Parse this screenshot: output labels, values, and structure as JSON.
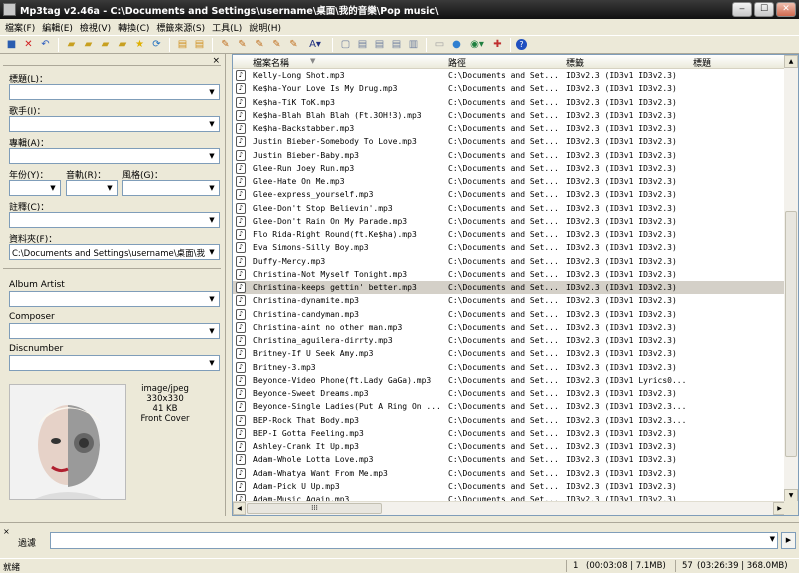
{
  "window": {
    "title": "Mp3tag v2.46a  -  C:\\Documents and Settings\\username\\桌面\\我的音樂\\Pop music\\",
    "min_glyph": "‒",
    "max_glyph": "☐",
    "close_glyph": "✕"
  },
  "menu": [
    "檔案(F)",
    "編輯(E)",
    "檢視(V)",
    "轉換(C)",
    "標籤來源(S)",
    "工具(L)",
    "說明(H)"
  ],
  "toolbar_icons": [
    "save-icon",
    "remove-tag-icon",
    "undo-icon",
    "change-dir-icon",
    "add-dir-icon",
    "open-folder-icon",
    "folder-icon",
    "favorite-star-icon",
    "refresh-icon",
    "tag-to-filename-icon",
    "filename-to-tag-icon",
    "format-icon",
    "actions-icon",
    "quick-action-icon",
    "convert-icon",
    "web-source-icon",
    "case-conversion-icon",
    "edit-icon",
    "text-export-icon",
    "playlist-icon",
    "tag-sources-icon",
    "print-icon",
    "web-icon",
    "options-icon",
    "tools-icon",
    "help-icon"
  ],
  "left_panel": {
    "close_glyph": "×",
    "title_label": "標題(L)：",
    "artist_label": "歌手(I)：",
    "album_label": "專輯(A)：",
    "year_label": "年份(Y)：",
    "track_label": "音軌(R)：",
    "genre_label": "風格(G)：",
    "comment_label": "註釋(C)：",
    "directory_label": "資料夾(F)：",
    "directory_value": "C:\\Documents and Settings\\username\\桌面\\我的音",
    "album_artist_label": "Album Artist",
    "composer_label": "Composer",
    "discnumber_label": "Discnumber",
    "cover": {
      "mime": "image/jpeg",
      "dimensions": "330x330",
      "size": "41 KB",
      "type": "Front Cover"
    }
  },
  "file_list": {
    "columns": [
      "檔案名稱",
      "路徑",
      "標籤",
      "標題"
    ],
    "selected_index": 16,
    "rows": [
      {
        "file": "Kelly-Long Shot.mp3",
        "path": "C:\\Documents and Set...",
        "tag": "ID3v2.3 (ID3v1 ID3v2.3)"
      },
      {
        "file": "Ke$ha-Your Love Is My Drug.mp3",
        "path": "C:\\Documents and Set...",
        "tag": "ID3v2.3 (ID3v1 ID3v2.3)"
      },
      {
        "file": "Ke$ha-TiK ToK.mp3",
        "path": "C:\\Documents and Set...",
        "tag": "ID3v2.3 (ID3v1 ID3v2.3)"
      },
      {
        "file": "Ke$ha-Blah Blah Blah (Ft.3OH!3).mp3",
        "path": "C:\\Documents and Set...",
        "tag": "ID3v2.3 (ID3v1 ID3v2.3)"
      },
      {
        "file": "Ke$ha-Backstabber.mp3",
        "path": "C:\\Documents and Set...",
        "tag": "ID3v2.3 (ID3v1 ID3v2.3)"
      },
      {
        "file": "Justin Bieber-Somebody To Love.mp3",
        "path": "C:\\Documents and Set...",
        "tag": "ID3v2.3 (ID3v1 ID3v2.3)"
      },
      {
        "file": "Justin Bieber-Baby.mp3",
        "path": "C:\\Documents and Set...",
        "tag": "ID3v2.3 (ID3v1 ID3v2.3)"
      },
      {
        "file": "Glee-Run Joey Run.mp3",
        "path": "C:\\Documents and Set...",
        "tag": "ID3v2.3 (ID3v1 ID3v2.3)"
      },
      {
        "file": "Glee-Hate On Me.mp3",
        "path": "C:\\Documents and Set...",
        "tag": "ID3v2.3 (ID3v1 ID3v2.3)"
      },
      {
        "file": "Glee-express_yourself.mp3",
        "path": "C:\\Documents and Set...",
        "tag": "ID3v2.3 (ID3v1 ID3v2.3)"
      },
      {
        "file": "Glee-Don't Stop Believin'.mp3",
        "path": "C:\\Documents and Set...",
        "tag": "ID3v2.3 (ID3v1 ID3v2.3)"
      },
      {
        "file": "Glee-Don't Rain On My Parade.mp3",
        "path": "C:\\Documents and Set...",
        "tag": "ID3v2.3 (ID3v1 ID3v2.3)"
      },
      {
        "file": "Flo Rida-Right Round(ft.Ke$ha).mp3",
        "path": "C:\\Documents and Set...",
        "tag": "ID3v2.3 (ID3v1 ID3v2.3)"
      },
      {
        "file": "Eva Simons-Silly Boy.mp3",
        "path": "C:\\Documents and Set...",
        "tag": "ID3v2.3 (ID3v1 ID3v2.3)"
      },
      {
        "file": "Duffy-Mercy.mp3",
        "path": "C:\\Documents and Set...",
        "tag": "ID3v2.3 (ID3v1 ID3v2.3)"
      },
      {
        "file": "Christina-Not Myself Tonight.mp3",
        "path": "C:\\Documents and Set...",
        "tag": "ID3v2.3 (ID3v1 ID3v2.3)"
      },
      {
        "file": "Christina-keeps gettin' better.mp3",
        "path": "C:\\Documents and Set...",
        "tag": "ID3v2.3 (ID3v1 ID3v2.3)"
      },
      {
        "file": "Christina-dynamite.mp3",
        "path": "C:\\Documents and Set...",
        "tag": "ID3v2.3 (ID3v1 ID3v2.3)"
      },
      {
        "file": "Christina-candyman.mp3",
        "path": "C:\\Documents and Set...",
        "tag": "ID3v2.3 (ID3v1 ID3v2.3)"
      },
      {
        "file": "Christina-aint no other man.mp3",
        "path": "C:\\Documents and Set...",
        "tag": "ID3v2.3 (ID3v1 ID3v2.3)"
      },
      {
        "file": "Christina_aguilera-dirrty.mp3",
        "path": "C:\\Documents and Set...",
        "tag": "ID3v2.3 (ID3v1 ID3v2.3)"
      },
      {
        "file": "Britney-If U Seek Amy.mp3",
        "path": "C:\\Documents and Set...",
        "tag": "ID3v2.3 (ID3v1 ID3v2.3)"
      },
      {
        "file": "Britney-3.mp3",
        "path": "C:\\Documents and Set...",
        "tag": "ID3v2.3 (ID3v1 ID3v2.3)"
      },
      {
        "file": "Beyonce-Video Phone(ft.Lady GaGa).mp3",
        "path": "C:\\Documents and Set...",
        "tag": "ID3v2.3 (ID3v1 Lyrics0..."
      },
      {
        "file": "Beyonce-Sweet Dreams.mp3",
        "path": "C:\\Documents and Set...",
        "tag": "ID3v2.3 (ID3v1 ID3v2.3)"
      },
      {
        "file": "Beyonce-Single Ladies(Put A Ring On ...",
        "path": "C:\\Documents and Set...",
        "tag": "ID3v2.3 (ID3v1 ID3v2.3..."
      },
      {
        "file": "BEP-Rock That Body.mp3",
        "path": "C:\\Documents and Set...",
        "tag": "ID3v2.3 (ID3v1 ID3v2.3..."
      },
      {
        "file": "BEP-I Gotta Feeling.mp3",
        "path": "C:\\Documents and Set...",
        "tag": "ID3v2.3 (ID3v1 ID3v2.3)"
      },
      {
        "file": "Ashley-Crank It Up.mp3",
        "path": "C:\\Documents and Set...",
        "tag": "ID3v2.3 (ID3v1 ID3v2.3)"
      },
      {
        "file": "Adam-Whole Lotta Love.mp3",
        "path": "C:\\Documents and Set...",
        "tag": "ID3v2.3 (ID3v1 ID3v2.3)"
      },
      {
        "file": "Adam-Whatya Want From Me.mp3",
        "path": "C:\\Documents and Set...",
        "tag": "ID3v2.3 (ID3v1 ID3v2.3)"
      },
      {
        "file": "Adam-Pick U Up.mp3",
        "path": "C:\\Documents and Set...",
        "tag": "ID3v2.3 (ID3v1 ID3v2.3)"
      },
      {
        "file": "Adam-Music Again.mp3",
        "path": "C:\\Documents and Set...",
        "tag": "ID3v2.3 (ID3v1 ID3v2.3)"
      }
    ]
  },
  "filter": {
    "close_glyph": "×",
    "label": "過濾",
    "value": ""
  },
  "status": {
    "text": "就緒",
    "selected_count": "1",
    "selected_info": "(00:03:08 | 7.1MB)",
    "total_count": "57",
    "total_info": "(03:26:39 | 368.0MB)"
  }
}
